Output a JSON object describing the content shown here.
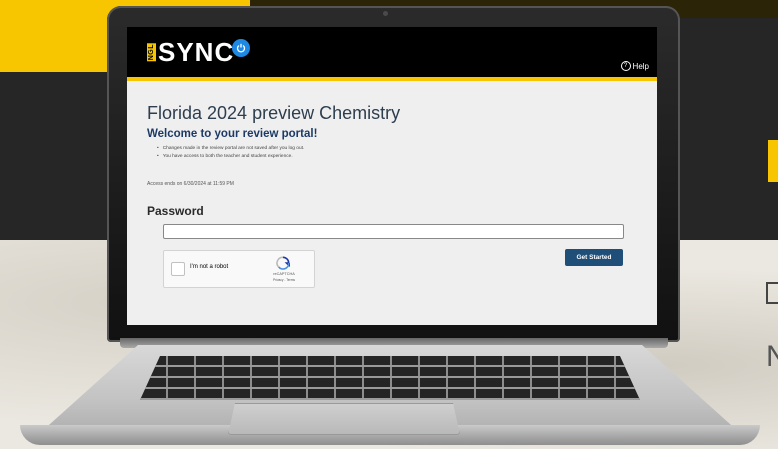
{
  "app": {
    "logo_prefix": "NGL",
    "logo_text": "SYNC",
    "help_label": "Help"
  },
  "main": {
    "title": "Florida 2024 preview Chemistry",
    "welcome": "Welcome to your review portal!",
    "bullets": [
      "Changes made in the review portal are not saved after you log out.",
      "You have access to both the teacher and student experience."
    ],
    "access_note": "Access ends on 6/30/2024 at 11:59 PM",
    "password_label": "Password",
    "password_value": ""
  },
  "captcha": {
    "label": "I'm not a robot",
    "brand": "reCAPTCHA",
    "links": "Privacy - Terms"
  },
  "actions": {
    "start_label": "Get Started"
  },
  "colors": {
    "brand_yellow": "#f7c600",
    "header_black": "#000000",
    "button_blue": "#1f4e79",
    "title_blue": "#1d3a66"
  },
  "background": {
    "side_letter": "N"
  }
}
